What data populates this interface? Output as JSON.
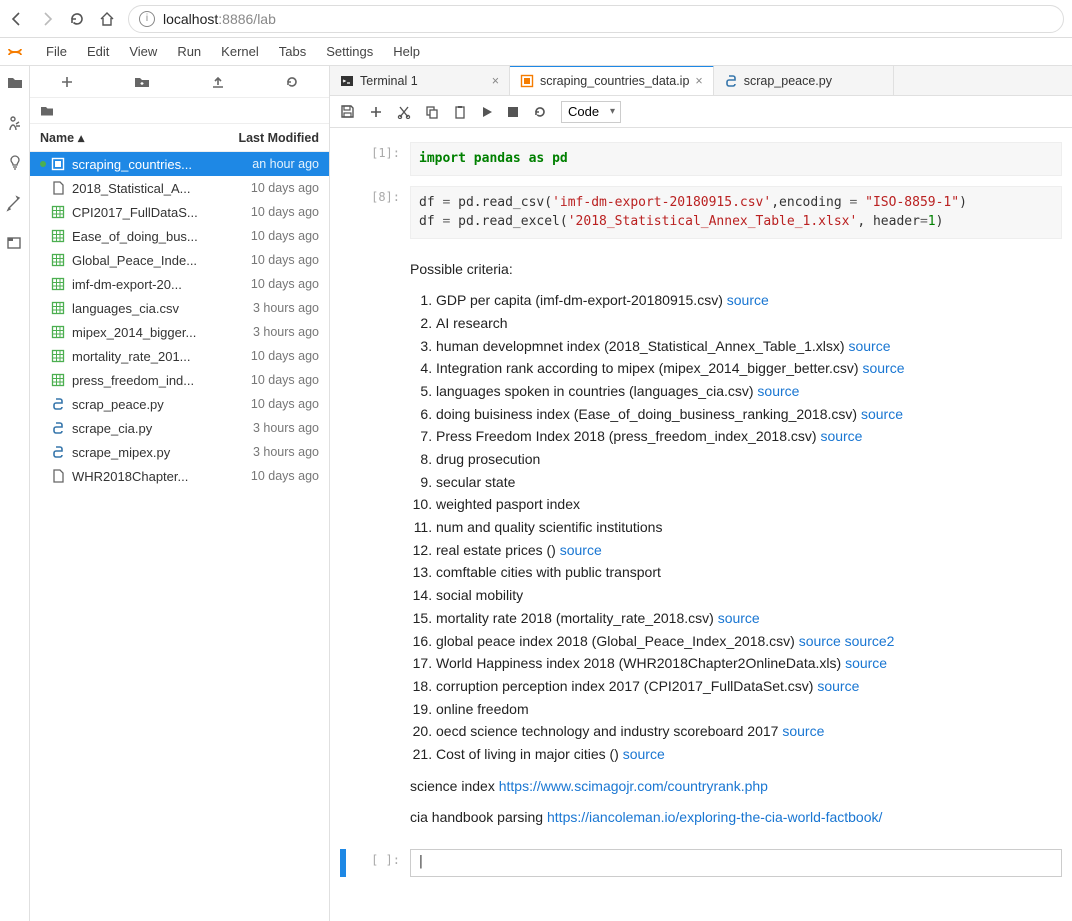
{
  "browser": {
    "url_info_letter": "i",
    "url_host": "localhost",
    "url_port_path": ":8886/lab"
  },
  "menus": [
    "File",
    "Edit",
    "View",
    "Run",
    "Kernel",
    "Tabs",
    "Settings",
    "Help"
  ],
  "fb": {
    "col_name": "Name",
    "col_sort": "▴",
    "col_mod": "Last Modified",
    "items": [
      {
        "name": "scraping_countries...",
        "mod": "an hour ago",
        "icon": "nb",
        "selected": true,
        "running": true
      },
      {
        "name": "2018_Statistical_A...",
        "mod": "10 days ago",
        "icon": "file"
      },
      {
        "name": "CPI2017_FullDataS...",
        "mod": "10 days ago",
        "icon": "csv"
      },
      {
        "name": "Ease_of_doing_bus...",
        "mod": "10 days ago",
        "icon": "csv"
      },
      {
        "name": "Global_Peace_Inde...",
        "mod": "10 days ago",
        "icon": "csv"
      },
      {
        "name": "imf-dm-export-20...",
        "mod": "10 days ago",
        "icon": "csv"
      },
      {
        "name": "languages_cia.csv",
        "mod": "3 hours ago",
        "icon": "csv"
      },
      {
        "name": "mipex_2014_bigger...",
        "mod": "3 hours ago",
        "icon": "csv"
      },
      {
        "name": "mortality_rate_201...",
        "mod": "10 days ago",
        "icon": "csv"
      },
      {
        "name": "press_freedom_ind...",
        "mod": "10 days ago",
        "icon": "csv"
      },
      {
        "name": "scrap_peace.py",
        "mod": "10 days ago",
        "icon": "py"
      },
      {
        "name": "scrape_cia.py",
        "mod": "3 hours ago",
        "icon": "py"
      },
      {
        "name": "scrape_mipex.py",
        "mod": "3 hours ago",
        "icon": "py"
      },
      {
        "name": "WHR2018Chapter...",
        "mod": "10 days ago",
        "icon": "file"
      }
    ]
  },
  "tabs": [
    {
      "label": "Terminal 1",
      "icon": "term",
      "active": false
    },
    {
      "label": "scraping_countries_data.ip",
      "icon": "nb",
      "active": true
    },
    {
      "label": "scrap_peace.py",
      "icon": "py",
      "active": false,
      "no_close": true
    }
  ],
  "celltype": "Code",
  "cell1": {
    "prompt": "[1]:",
    "code_html": "<span class='kw-green'>import</span> <span class='kw-green'>pandas</span> <span class='kw-green'>as</span> <span class='kw-green'>pd</span>"
  },
  "cell2": {
    "prompt": "[8]:",
    "line1_html": "df <span class='kw-op'>=</span> pd.read_csv(<span class='kw-str'>'imf-dm-export-20180915.csv'</span>,encoding <span class='kw-op'>=</span> <span class='kw-str'>\"ISO-8859-1\"</span>)",
    "line2_html": "df <span class='kw-op'>=</span> pd.read_excel(<span class='kw-str'>'2018_Statistical_Annex_Table_1.xlsx'</span>, header<span class='kw-op'>=</span><span class='kw-num'>1</span>)"
  },
  "md": {
    "intro": "Possible criteria:",
    "items": [
      {
        "t": "GDP per capita (imf-dm-export-20180915.csv) ",
        "links": [
          "source"
        ]
      },
      {
        "t": "AI research"
      },
      {
        "t": "human developmnet index (2018_Statistical_Annex_Table_1.xlsx) ",
        "links": [
          "source"
        ]
      },
      {
        "t": "Integration rank according to mipex (mipex_2014_bigger_better.csv) ",
        "links": [
          "source"
        ]
      },
      {
        "t": "languages spoken in countries (languages_cia.csv) ",
        "links": [
          "source"
        ]
      },
      {
        "t": "doing buisiness index (Ease_of_doing_business_ranking_2018.csv) ",
        "links": [
          "source"
        ]
      },
      {
        "t": "Press Freedom Index 2018 (press_freedom_index_2018.csv) ",
        "links": [
          "source"
        ]
      },
      {
        "t": "drug prosecution"
      },
      {
        "t": "secular state"
      },
      {
        "t": "weighted pasport index"
      },
      {
        "t": "num and quality scientific institutions"
      },
      {
        "t": "real estate prices () ",
        "links": [
          "source"
        ]
      },
      {
        "t": "comftable cities with public transport"
      },
      {
        "t": "social mobility"
      },
      {
        "t": "mortality rate 2018 (mortality_rate_2018.csv) ",
        "links": [
          "source"
        ]
      },
      {
        "t": "global peace index 2018 (Global_Peace_Index_2018.csv) ",
        "links": [
          "source",
          "source2"
        ]
      },
      {
        "t": "World Happiness index 2018 (WHR2018Chapter2OnlineData.xls) ",
        "links": [
          "source"
        ]
      },
      {
        "t": "corruption perception index 2017 (CPI2017_FullDataSet.csv) ",
        "links": [
          "source"
        ]
      },
      {
        "t": "online freedom"
      },
      {
        "t": "oecd science technology and industry scoreboard 2017 ",
        "links": [
          "source"
        ]
      },
      {
        "t": "Cost of living in major cities () ",
        "links": [
          "source"
        ]
      }
    ],
    "p1_pre": "science index ",
    "p1_link": "https://www.scimagojr.com/countryrank.php",
    "p2_pre": "cia handbook parsing ",
    "p2_link": "https://iancoleman.io/exploring-the-cia-world-factbook/"
  },
  "empty_prompt": "[ ]:"
}
